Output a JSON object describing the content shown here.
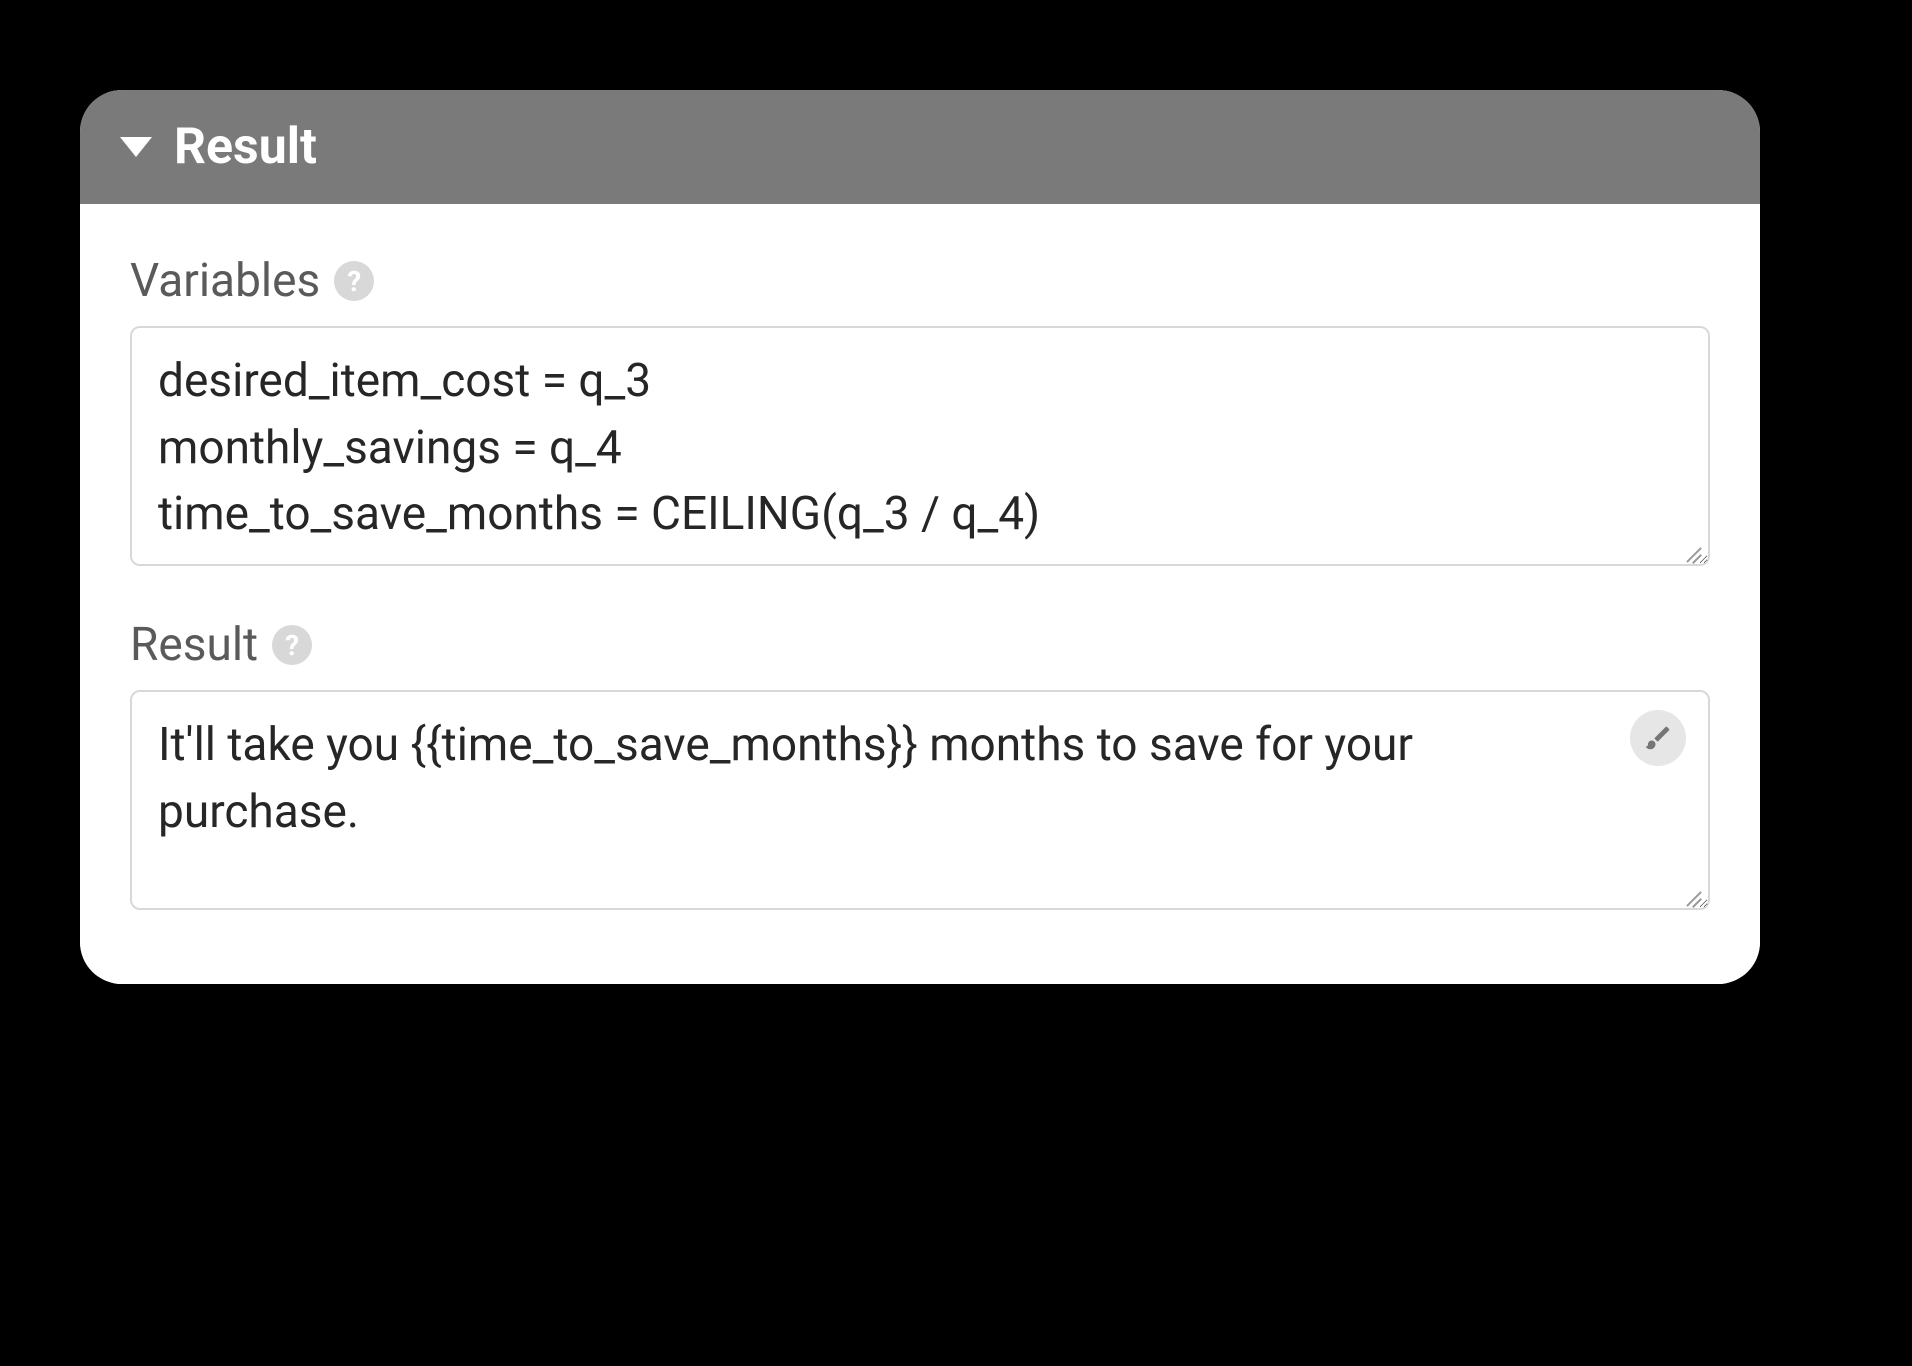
{
  "panel": {
    "title": "Result"
  },
  "fields": {
    "variables": {
      "label": "Variables",
      "value": "desired_item_cost = q_3\nmonthly_savings = q_4\ntime_to_save_months = CEILING(q_3 / q_4)"
    },
    "result": {
      "label": "Result",
      "value": "It'll take you {{time_to_save_months}} months to save for your purchase."
    }
  },
  "icons": {
    "help": "?",
    "brush": "brush-icon"
  }
}
